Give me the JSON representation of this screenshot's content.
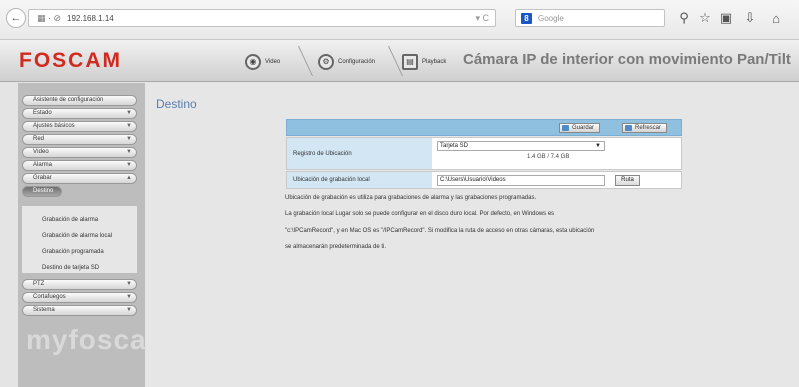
{
  "browser": {
    "back_icon": "back-arrow-icon",
    "url": "192.168.1.14",
    "url_prefix_icons": "▦ · ⊘",
    "url_actions": "▾ C",
    "search_placeholder": "Google",
    "search_engine_letter": "8",
    "toolbar_icons": [
      "search-icon",
      "star-icon",
      "clipboard-icon",
      "download-icon",
      "home-icon"
    ]
  },
  "header": {
    "logo": "FOSCAM",
    "tabs": [
      {
        "label": "Video",
        "icon": "video-icon"
      },
      {
        "label": "Configuración",
        "icon": "gear-icon"
      },
      {
        "label": "Playback",
        "icon": "playback-icon"
      }
    ],
    "camera_title": "Cámara IP de interior con movimiento Pan/Tilt"
  },
  "sidebar": {
    "items": [
      {
        "label": "Asistente de configuración"
      },
      {
        "label": "Estado"
      },
      {
        "label": "Ajustes básicos"
      },
      {
        "label": "Red"
      },
      {
        "label": "Vídeo"
      },
      {
        "label": "Alarma"
      },
      {
        "label": "Grabar"
      },
      {
        "label": "Destino",
        "active": true
      }
    ],
    "subitems": [
      "Grabación de alarma",
      "Grabación de alarma local",
      "Grabación programada",
      "Destino de tarjeta SD"
    ],
    "bottom_items": [
      "PTZ",
      "Cortafuegos",
      "Sistema"
    ],
    "watermark": "myfoscam.es"
  },
  "main": {
    "title": "Destino",
    "save_label": "Guardar",
    "refresh_label": "Refrescar",
    "record_location_label": "Registro de Ubicación",
    "record_location_value": "Tarjeta SD",
    "sd_quota": "1.4 GB / 7.4 GB",
    "local_path_label": "Ubicación de grabación local",
    "local_path_value": "C:\\Users\\Usuario\\Videos",
    "browse_label": "Ruta",
    "notes": [
      "Ubicación de grabación es utiliza para grabaciones de alarma y las grabaciones programadas.",
      "La grabación local Lugar solo se puede configurar en el disco duro local. Por defecto, en Windows es",
      "\"c:\\IPCamRecord\", y en Mac OS es \"/IPCamRecord\". Si modifica la ruta de acceso en otras cámaras, esta ubicación",
      "se almacenarán predeterminada de ti."
    ]
  }
}
